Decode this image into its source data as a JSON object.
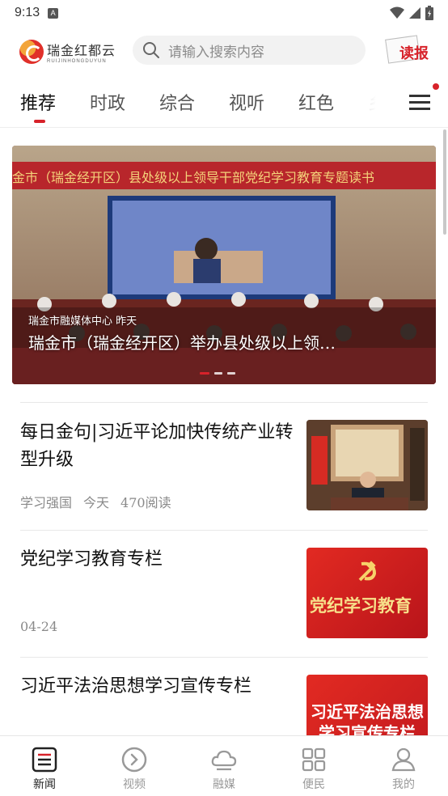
{
  "status_bar": {
    "time": "9:13",
    "a_badge": "A"
  },
  "header": {
    "logo_cn": "瑞金红都云",
    "logo_en": "RUIJINHONGDUYUN",
    "search_placeholder": "请输入搜索内容",
    "readpaper_label": "读报"
  },
  "tabs": [
    "推荐",
    "时政",
    "综合",
    "视听",
    "红色",
    "乡"
  ],
  "active_tab": "推荐",
  "banner": {
    "source": "瑞金市融媒体中心  昨天",
    "title": "瑞金市（瑞金经开区）举办县处级以上领…",
    "slogan": "金市（瑞金经开区）县处级以上领导干部党纪学习教育专题读书",
    "slide_count": 3,
    "active_slide": 0
  },
  "news": [
    {
      "title": "每日金句|习近平论加快传统产业转型升级",
      "meta": [
        "学习强国",
        "今天",
        "470阅读"
      ]
    },
    {
      "title": "党纪学习教育专栏",
      "meta": [
        "04-24"
      ],
      "thumb_text": "党纪学习教育"
    },
    {
      "title": "习近平法治思想学习宣传专栏",
      "meta": [],
      "thumb_text_line1": "习近平法治思想",
      "thumb_text_line2": "学习宣传专栏"
    }
  ],
  "bottom_nav": [
    {
      "label": "新闻",
      "icon": "news-icon",
      "active": true
    },
    {
      "label": "视频",
      "icon": "play-icon",
      "active": false
    },
    {
      "label": "融媒",
      "icon": "cloud-icon",
      "active": false
    },
    {
      "label": "便民",
      "icon": "grid-icon",
      "active": false
    },
    {
      "label": "我的",
      "icon": "user-icon",
      "active": false
    }
  ],
  "colors": {
    "accent": "#d7222a",
    "text": "#111111",
    "meta": "#8a8a8a"
  }
}
